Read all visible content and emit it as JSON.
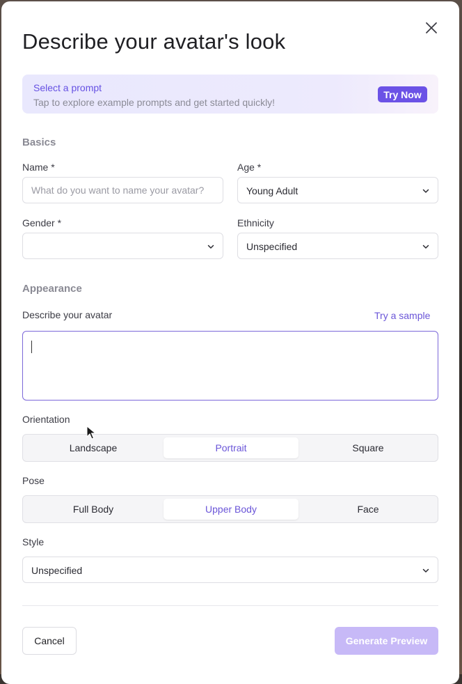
{
  "modal": {
    "title": "Describe your avatar's look"
  },
  "banner": {
    "title": "Select a prompt",
    "subtitle": "Tap to explore example prompts and get started quickly!",
    "button_label": "Try Now"
  },
  "basics": {
    "section_title": "Basics",
    "name": {
      "label": "Name *",
      "value": "",
      "placeholder": "What do you want to name your avatar?"
    },
    "age": {
      "label": "Age *",
      "value": "Young Adult"
    },
    "gender": {
      "label": "Gender *",
      "value": ""
    },
    "ethnicity": {
      "label": "Ethnicity",
      "value": "Unspecified"
    }
  },
  "appearance": {
    "section_title": "Appearance",
    "describe_label": "Describe your avatar",
    "try_sample_label": "Try a sample",
    "description_value": ""
  },
  "orientation": {
    "label": "Orientation",
    "options": [
      "Landscape",
      "Portrait",
      "Square"
    ],
    "selected": "Portrait"
  },
  "pose": {
    "label": "Pose",
    "options": [
      "Full Body",
      "Upper Body",
      "Face"
    ],
    "selected": "Upper Body"
  },
  "style": {
    "label": "Style",
    "value": "Unspecified"
  },
  "footer": {
    "cancel_label": "Cancel",
    "generate_label": "Generate Preview"
  },
  "icons": {
    "close": "close-icon",
    "chevron": "chevron-down-icon",
    "cursor": "mouse-pointer-icon"
  },
  "colors": {
    "accent": "#6b52e6",
    "accent_text": "#6a55d8",
    "generate_disabled": "#c7b9f7",
    "banner_bg": "#e9e8fd"
  }
}
